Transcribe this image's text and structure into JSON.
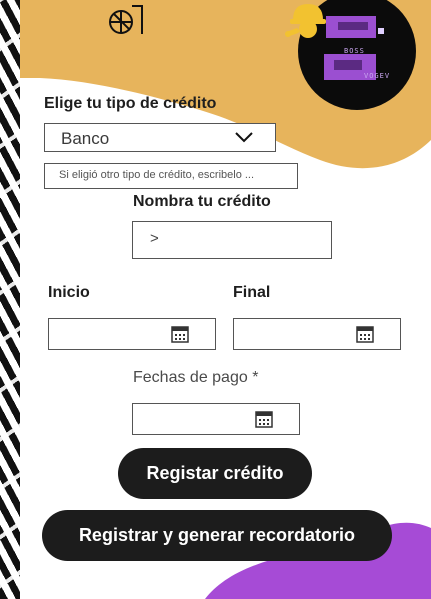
{
  "colors": {
    "accent_orange": "#E7B45C",
    "accent_purple": "#A64BD6",
    "button_bg": "#1C1C1C"
  },
  "header": {
    "logo_icon": "geometric-logo-icon",
    "worker_icon": "worker-wrench-icon",
    "avatar_text_top": "BOSS",
    "avatar_text_bottom": "VOGEV"
  },
  "form": {
    "credit_type_label": "Elige tu tipo de crédito",
    "credit_type_value": "Banco",
    "other_type_placeholder": "Si eligió otro tipo de crédito, escribelo ...",
    "name_label": "Nombra tu crédito",
    "name_value": ">",
    "start_label": "Inicio",
    "end_label": "Final",
    "payment_dates_label": "Fechas de pago *",
    "calendar_icon": "calendar-icon"
  },
  "actions": {
    "register_label": "Registar crédito",
    "register_reminder_label": "Registrar y generar recordatorio"
  }
}
